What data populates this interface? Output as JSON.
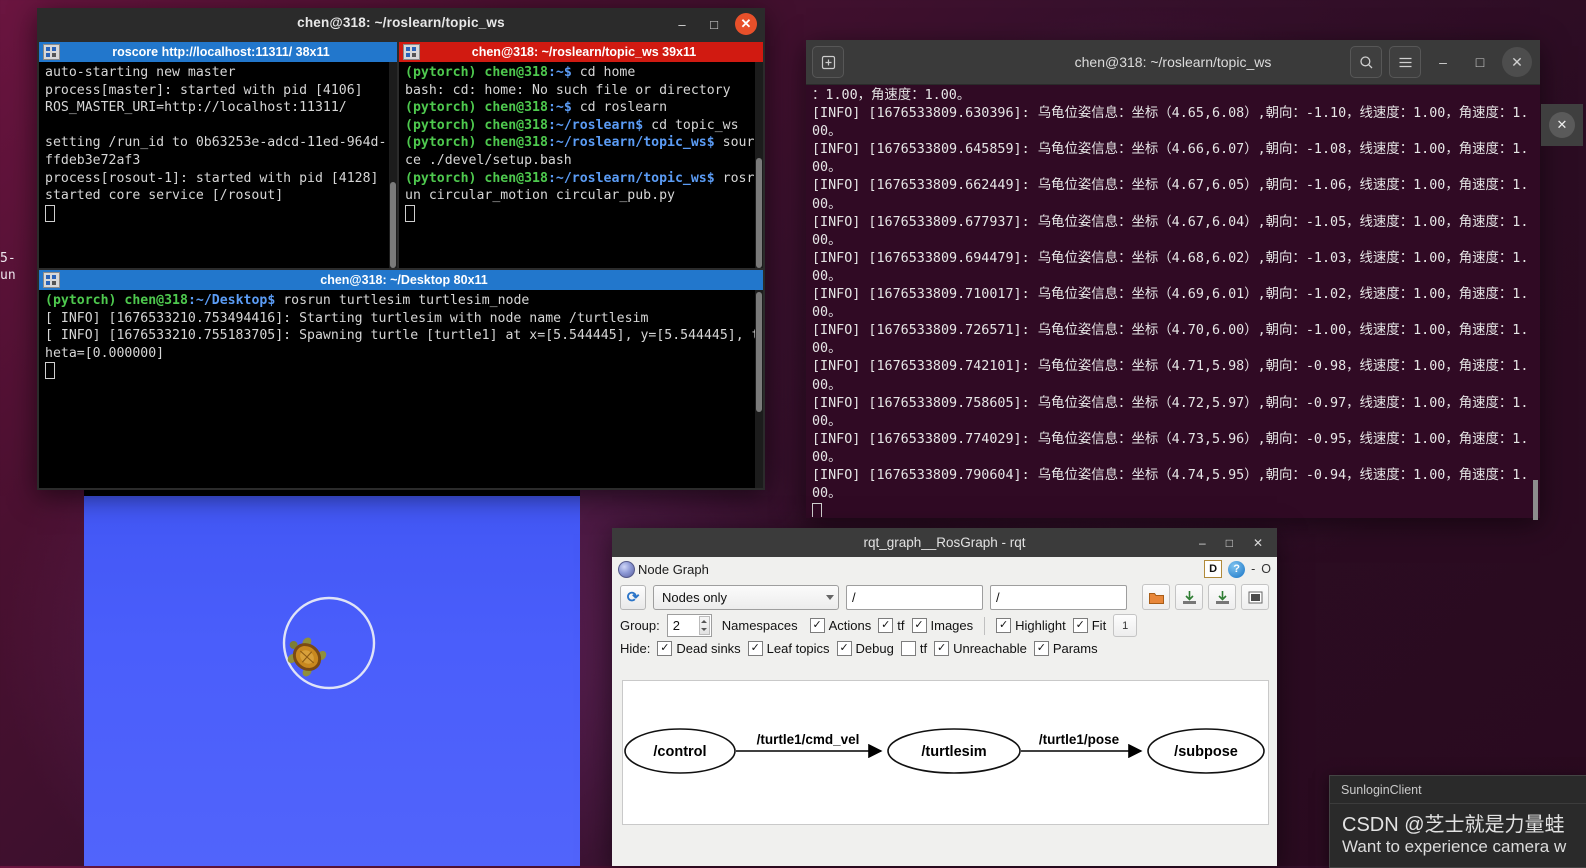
{
  "desktop": {
    "bg_fragment_line1": "5-",
    "bg_fragment_line2": "un"
  },
  "terminal_left": {
    "window_title": "chen@318: ~/roslearn/topic_ws",
    "window_buttons": {
      "minimize": "–",
      "maximize": "□",
      "close": "✕"
    },
    "panes": [
      {
        "id": "roscore",
        "header": "roscore http://localhost:11311/ 38x11",
        "header_color": "#2277cc",
        "lines": [
          "auto-starting new master",
          "process[master]: started with pid [4106]",
          "ROS_MASTER_URI=http://localhost:11311/",
          "",
          "setting /run_id to 0b63253e-adcd-11ed-964d-ffdeb3e72af3",
          "process[rosout-1]: started with pid [4128]",
          "started core service [/rosout]"
        ]
      },
      {
        "id": "publisher",
        "header": "chen@318: ~/roslearn/topic_ws 39x11",
        "header_color": "#d11a11",
        "lines": [
          {
            "env": "(pytorch)",
            "user": "chen@318",
            "path": ":~$",
            "cmd": " cd home"
          },
          {
            "plain": "bash: cd: home: No such file or directory"
          },
          {
            "env": "(pytorch)",
            "user": "chen@318",
            "path": ":~$",
            "cmd": " cd roslearn"
          },
          {
            "env": "(pytorch)",
            "user": "chen@318",
            "path": ":~/roslearn$",
            "cmd": " cd topic_ws"
          },
          {
            "env": "(pytorch)",
            "user": "chen@318",
            "path": ":~/roslearn/topic_ws$",
            "cmd": " source ./devel/setup.bash"
          },
          {
            "env": "(pytorch)",
            "user": "chen@318",
            "path": ":~/roslearn/topic_ws$",
            "cmd": " rosrun circular_motion circular_pub.py"
          }
        ]
      },
      {
        "id": "turtlesim-node",
        "header": "chen@318: ~/Desktop 80x11",
        "header_color": "#2277cc",
        "lines": [
          {
            "env": "(pytorch)",
            "user": "chen@318",
            "path": ":~/Desktop$",
            "cmd": " rosrun turtlesim turtlesim_node"
          },
          {
            "plain": "[ INFO] [1676533210.753494416]: Starting turtlesim with node name /turtlesim"
          },
          {
            "plain": "[ INFO] [1676533210.755183705]: Spawning turtle [turtle1] at x=[5.544445], y=[5.544445], theta=[0.000000]"
          }
        ]
      }
    ]
  },
  "terminal_right": {
    "window_title": "chen@318: ~/roslearn/topic_ws",
    "icons": {
      "new_tab": "new-tab-icon",
      "search": "search-icon",
      "menu": "hamburger-menu-icon",
      "minimize": "–",
      "maximize": "□",
      "close": "✕"
    },
    "first_partial_line": "：1.00，角速度：1.00。",
    "log_lines": [
      "[INFO] [1676533809.630396]: 乌龟位姿信息：坐标（4.65,6.08）,朝向：-1.10，线速度：1.00，角速度：1.00。",
      "[INFO] [1676533809.645859]: 乌龟位姿信息：坐标（4.66,6.07）,朝向：-1.08，线速度：1.00，角速度：1.00。",
      "[INFO] [1676533809.662449]: 乌龟位姿信息：坐标（4.67,6.05）,朝向：-1.06，线速度：1.00，角速度：1.00。",
      "[INFO] [1676533809.677937]: 乌龟位姿信息：坐标（4.67,6.04）,朝向：-1.05，线速度：1.00，角速度：1.00。",
      "[INFO] [1676533809.694479]: 乌龟位姿信息：坐标（4.68,6.02）,朝向：-1.03，线速度：1.00，角速度：1.00。",
      "[INFO] [1676533809.710017]: 乌龟位姿信息：坐标（4.69,6.01）,朝向：-1.02，线速度：1.00，角速度：1.00。",
      "[INFO] [1676533809.726571]: 乌龟位姿信息：坐标（4.70,6.00）,朝向：-1.00，线速度：1.00，角速度：1.00。",
      "[INFO] [1676533809.742101]: 乌龟位姿信息：坐标（4.71,5.98）,朝向：-0.98，线速度：1.00，角速度：1.00。",
      "[INFO] [1676533809.758605]: 乌龟位姿信息：坐标（4.72,5.97）,朝向：-0.97，线速度：1.00，角速度：1.00。",
      "[INFO] [1676533809.774029]: 乌龟位姿信息：坐标（4.73,5.96）,朝向：-0.95，线速度：1.00，角速度：1.00。",
      "[INFO] [1676533809.790604]: 乌龟位姿信息：坐标（4.74,5.95）,朝向：-0.94，线速度：1.00，角速度：1.00。"
    ]
  },
  "turtlesim": {
    "background_color": "#4a5efb",
    "trail_color": "#d8dcf5",
    "turtle_shell_color": "#b5741f"
  },
  "rqt": {
    "window_title": "rqt_graph__RosGraph - rqt",
    "window_buttons": {
      "minimize": "–",
      "maximize": "□",
      "close": "✕"
    },
    "dock_title": "Node Graph",
    "dock_badges": {
      "d": "D",
      "help": "?",
      "minimize": "-",
      "float": "O"
    },
    "toolbar": {
      "refresh_label": "⟳",
      "filter_select": "Nodes only",
      "topic_filter_1": "/",
      "topic_filter_2": "/",
      "buttons": [
        "open-folder-icon",
        "save-dot-icon",
        "save-image-icon",
        "fit-view-icon"
      ]
    },
    "group_row": {
      "group_label": "Group:",
      "group_value": "2",
      "namespaces_label": "Namespaces",
      "checks": [
        {
          "label": "Actions",
          "checked": true
        },
        {
          "label": "tf",
          "checked": true
        },
        {
          "label": "Images",
          "checked": true
        },
        {
          "label": "Highlight",
          "checked": true
        },
        {
          "label": "Fit",
          "checked": true
        }
      ],
      "count_button": "1"
    },
    "hide_row": {
      "hide_label": "Hide:",
      "checks": [
        {
          "label": "Dead sinks",
          "checked": true
        },
        {
          "label": "Leaf topics",
          "checked": true
        },
        {
          "label": "Debug",
          "checked": true
        },
        {
          "label": "tf",
          "checked": false
        },
        {
          "label": "Unreachable",
          "checked": true
        },
        {
          "label": "Params",
          "checked": true
        }
      ]
    },
    "graph": {
      "nodes": [
        {
          "id": "control",
          "label": "/control"
        },
        {
          "id": "turtlesim",
          "label": "/turtlesim"
        },
        {
          "id": "subpose",
          "label": "/subpose"
        }
      ],
      "edges": [
        {
          "from": "control",
          "to": "turtlesim",
          "label": "/turtle1/cmd_vel"
        },
        {
          "from": "turtlesim",
          "to": "subpose",
          "label": "/turtle1/pose"
        }
      ]
    }
  },
  "sunlogin": {
    "title": "SunloginClient",
    "line1": "CSDN @芝士就是力量蛙",
    "line2": "Want to experience camera w"
  }
}
